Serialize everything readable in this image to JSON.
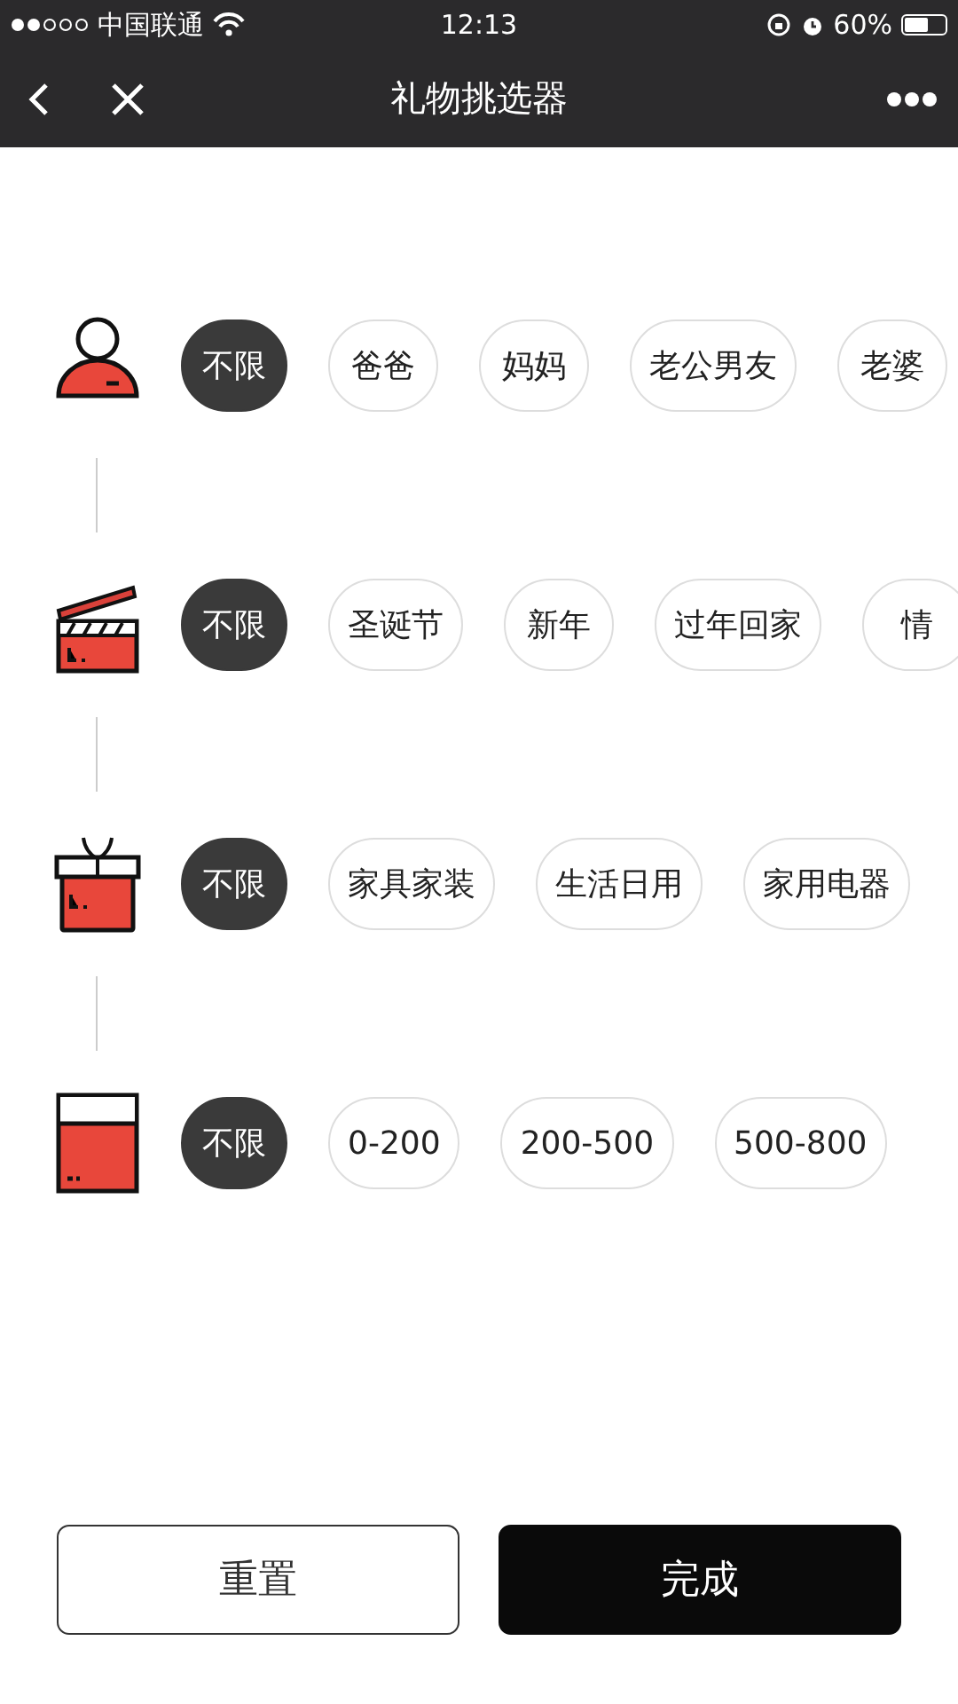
{
  "status_bar": {
    "carrier": "中国联通",
    "time": "12:13",
    "battery": "60%"
  },
  "nav": {
    "title": "礼物挑选器"
  },
  "filters": [
    {
      "kind": "person",
      "options": [
        {
          "label": "不限",
          "selected": true
        },
        {
          "label": "爸爸",
          "selected": false
        },
        {
          "label": "妈妈",
          "selected": false
        },
        {
          "label": "老公男友",
          "selected": false
        },
        {
          "label": "老婆",
          "selected": false
        }
      ]
    },
    {
      "kind": "clapper",
      "options": [
        {
          "label": "不限",
          "selected": true
        },
        {
          "label": "圣诞节",
          "selected": false
        },
        {
          "label": "新年",
          "selected": false
        },
        {
          "label": "过年回家",
          "selected": false
        },
        {
          "label": "情",
          "selected": false
        }
      ]
    },
    {
      "kind": "gift",
      "options": [
        {
          "label": "不限",
          "selected": true
        },
        {
          "label": "家具家装",
          "selected": false
        },
        {
          "label": "生活日用",
          "selected": false
        },
        {
          "label": "家用电器",
          "selected": false
        }
      ]
    },
    {
      "kind": "box",
      "options": [
        {
          "label": "不限",
          "selected": true
        },
        {
          "label": "0-200",
          "selected": false
        },
        {
          "label": "200-500",
          "selected": false
        },
        {
          "label": "500-800",
          "selected": false
        }
      ]
    }
  ],
  "buttons": [
    {
      "label": "重置",
      "kind": "outline"
    },
    {
      "label": "完成",
      "kind": "solid"
    }
  ]
}
